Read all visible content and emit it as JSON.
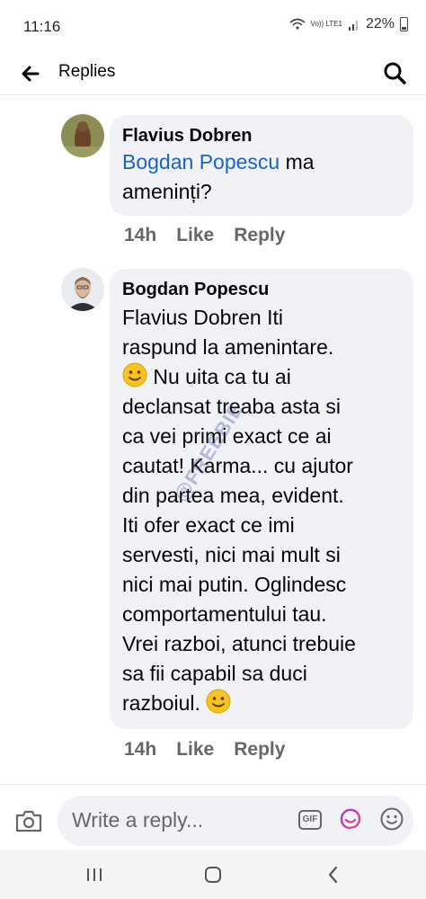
{
  "status_bar": {
    "time": "11:16",
    "network": "Vo)) LTE1",
    "battery": "22%"
  },
  "header": {
    "title": "Replies"
  },
  "comments": [
    {
      "author": "Flavius Dobren",
      "mention": "Bogdan Popescu",
      "text_lines": [
        " ma",
        "ameninți?"
      ],
      "time": "14h",
      "like_label": "Like",
      "reply_label": "Reply"
    },
    {
      "author": "Bogdan Popescu",
      "lines": [
        "Flavius Dobren Iti",
        "raspund la amenintare.",
        " Nu uita ca tu ai",
        "declansat treaba asta si",
        "ca vei primi exact ce ai",
        "cautat! Karma... cu ajutor",
        "din partea mea, evident.",
        "Iti ofer exact ce imi",
        "servesti, nici mai mult si",
        "nici mai putin. Oglindesc",
        "comportamentului tau.",
        "Vrei razboi, atunci trebuie",
        "sa fii capabil sa duci",
        "razboiul. "
      ],
      "time": "14h",
      "like_label": "Like",
      "reply_label": "Reply"
    }
  ],
  "watermark": "@FREEBIE",
  "reply_bar": {
    "placeholder": "Write a reply...",
    "gif_label": "GIF"
  },
  "icons": {
    "back": "arrow-left-icon",
    "search": "search-icon",
    "camera": "camera-icon",
    "sticker": "sticker-icon",
    "emoji": "emoji-icon"
  },
  "colors": {
    "mention": "#1a62c3",
    "bubble": "#f0f2f5",
    "meta": "#65676b"
  }
}
